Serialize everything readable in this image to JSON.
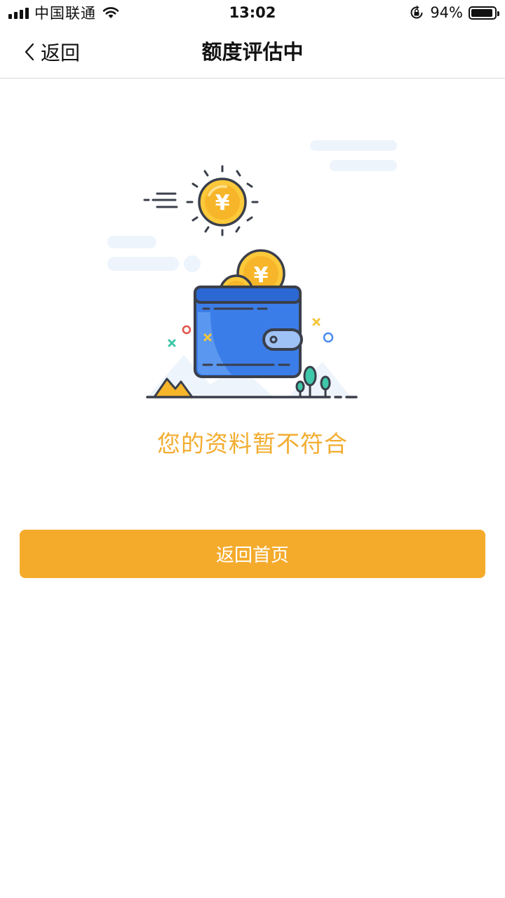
{
  "status_bar": {
    "carrier": "中国联通",
    "time": "13:02",
    "battery_percent": "94%",
    "battery_level": 0.94,
    "icons": [
      "signal-icon",
      "wifi-icon",
      "rotation-lock-icon",
      "battery-icon"
    ]
  },
  "nav": {
    "back_label": "返回",
    "title": "额度评估中",
    "back_icon": "chevron-left-icon"
  },
  "illustration": {
    "subject": "wallet-with-coins-illustration",
    "coin_symbol": "¥"
  },
  "result": {
    "message": "您的资料暂不符合"
  },
  "actions": {
    "home_button_label": "返回首页"
  },
  "colors": {
    "accent": "#f4ab2c",
    "message_text": "#f2ad31",
    "wallet_blue": "#3b7de8",
    "coin_yellow": "#fcc93a",
    "outline": "#3a3f4b"
  }
}
